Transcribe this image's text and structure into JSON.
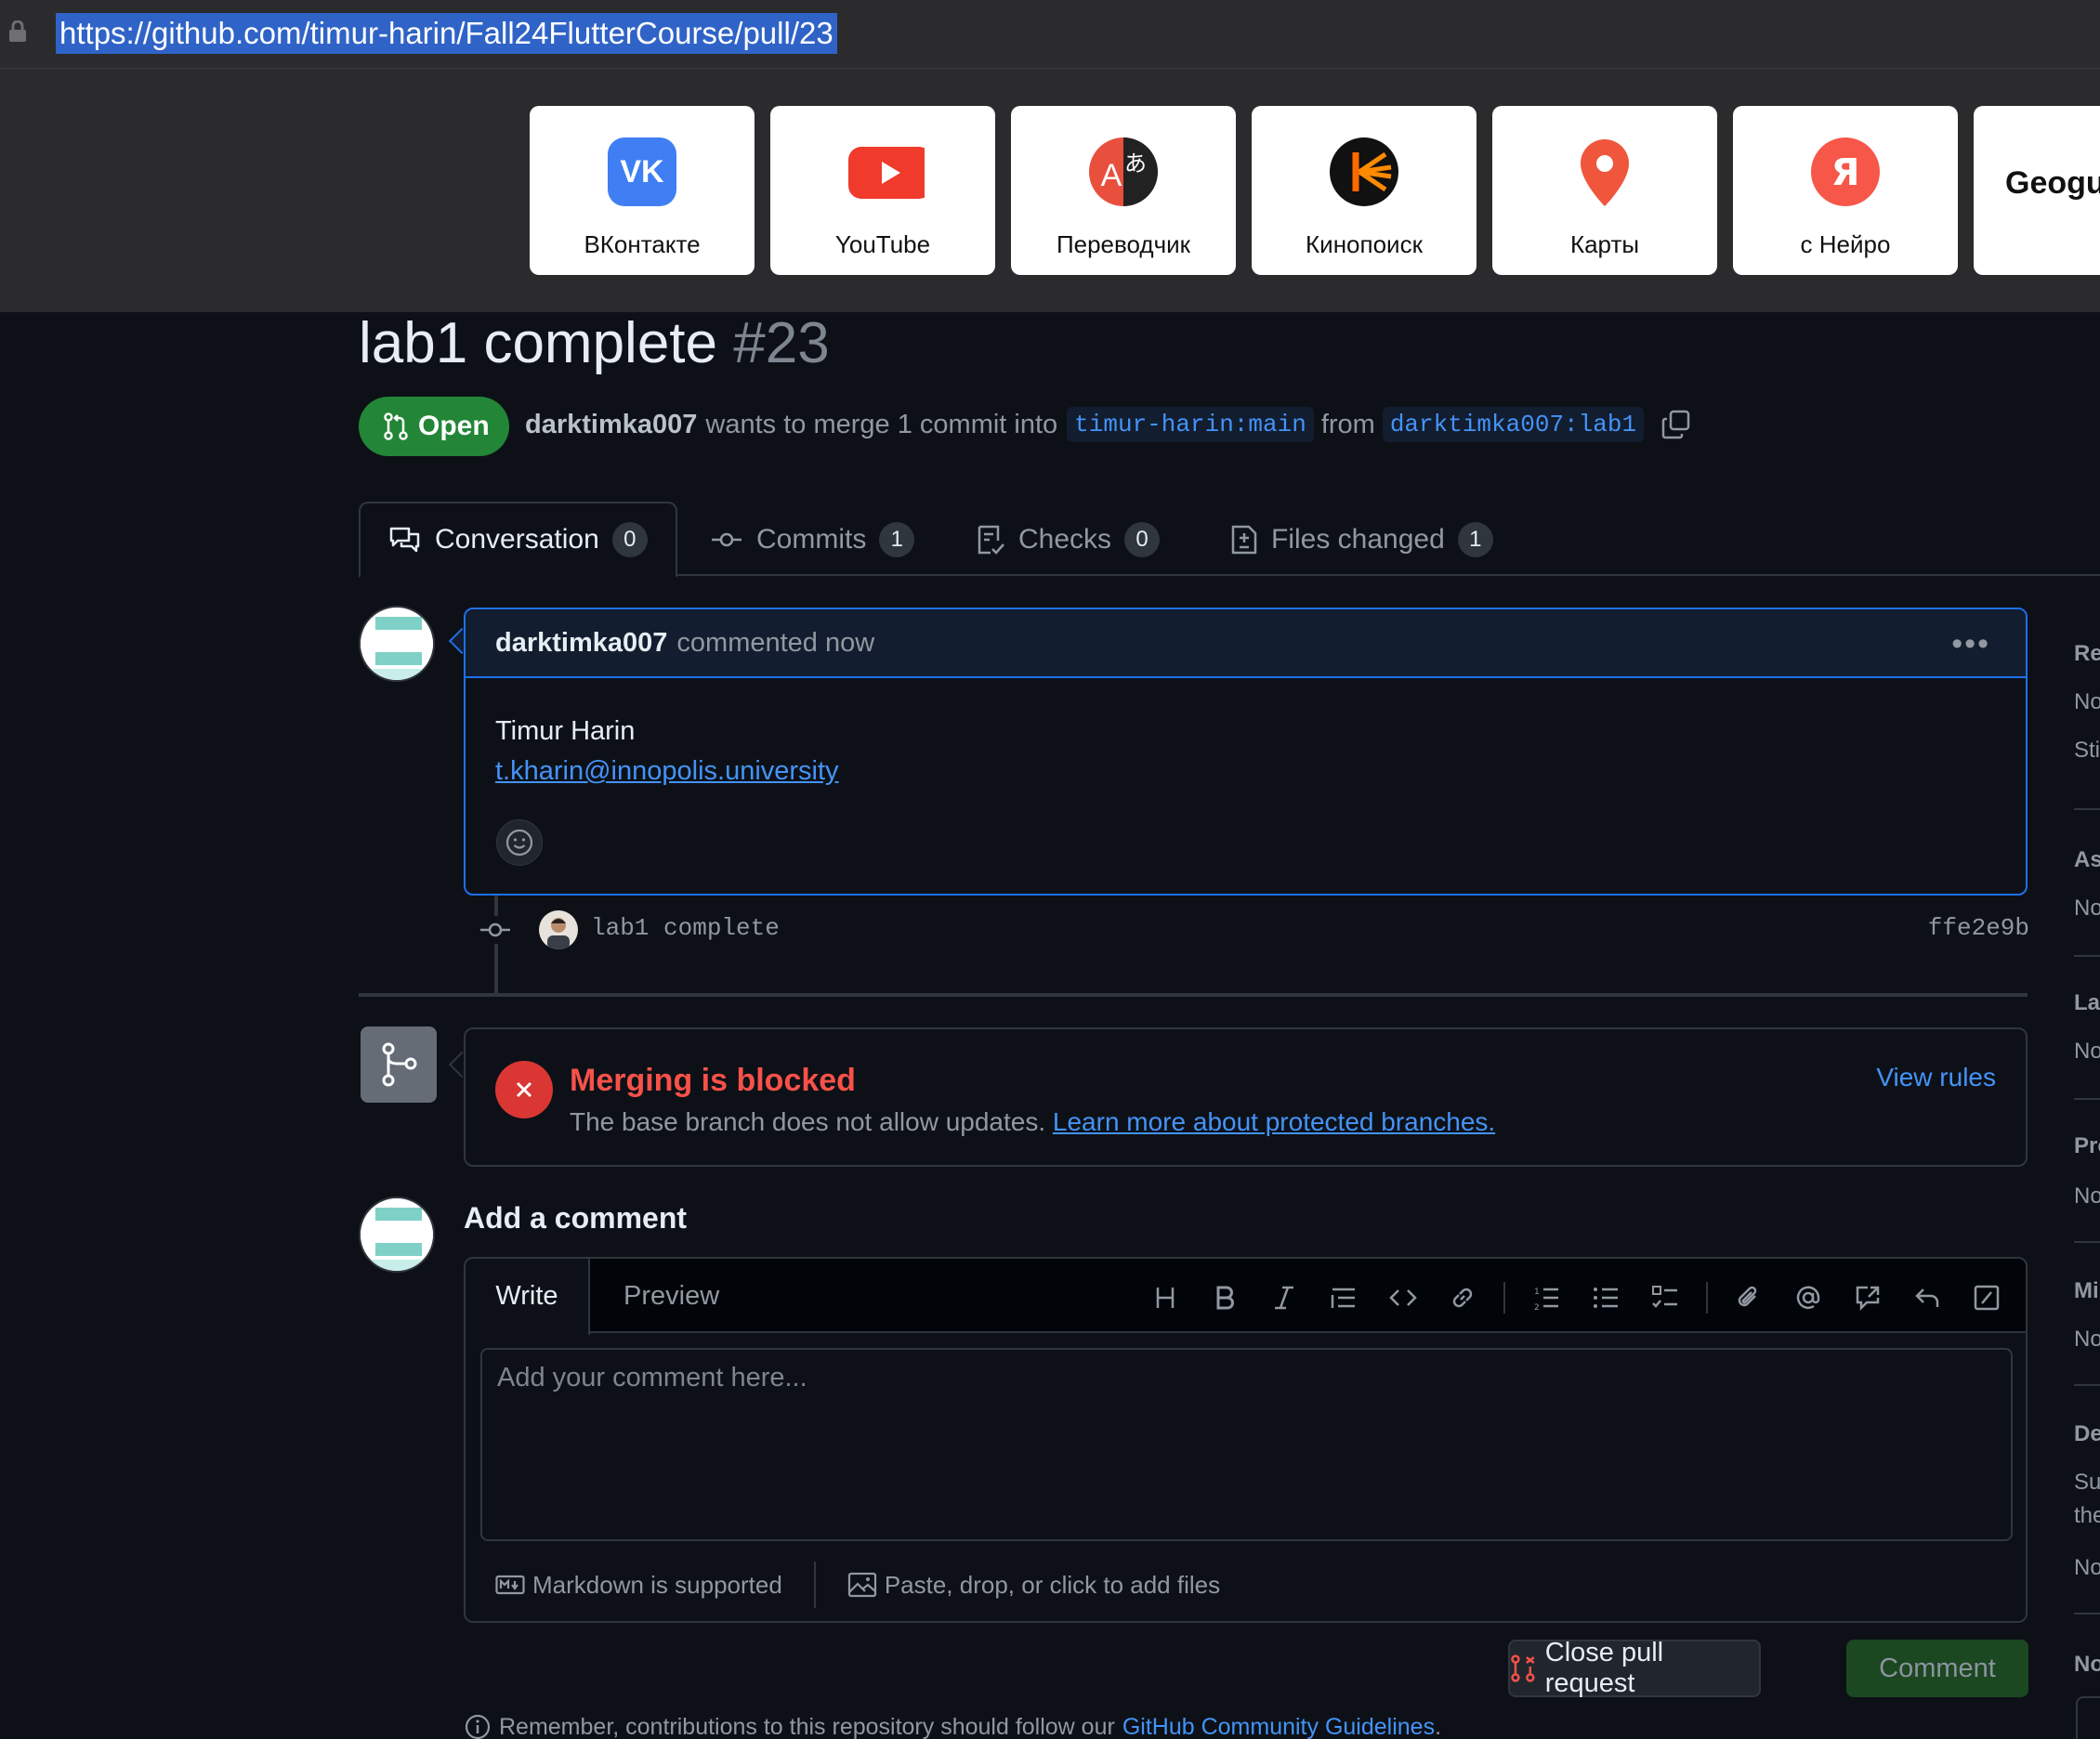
{
  "browser": {
    "url": "https://github.com/timur-harin/Fall24FlutterCourse/pull/23"
  },
  "speed_dial": [
    {
      "label": "ВКонтакте",
      "icon": "vk-icon",
      "color": "#3f7ff3"
    },
    {
      "label": "YouTube",
      "icon": "youtube-icon",
      "color": "#f03a2c"
    },
    {
      "label": "Переводчик",
      "icon": "translate-icon",
      "color": "#e8503d"
    },
    {
      "label": "Кинопоиск",
      "icon": "kinopoisk-icon",
      "color": "#ff6a00"
    },
    {
      "label": "Карты",
      "icon": "maps-pin-icon",
      "color": "#f0563b"
    },
    {
      "label": "с Нейро",
      "icon": "yandex-icon",
      "color": "#f65749"
    },
    {
      "label": "Geogu"
    }
  ],
  "pr": {
    "title": "lab1 complete",
    "number": "#23",
    "state": "Open",
    "author": "darktimka007",
    "merge_text": "wants to merge 1 commit into",
    "base_branch": "timur-harin:main",
    "from_text": "from",
    "head_branch": "darktimka007:lab1"
  },
  "tabs": [
    {
      "label": "Conversation",
      "count": "0"
    },
    {
      "label": "Commits",
      "count": "1"
    },
    {
      "label": "Checks",
      "count": "0"
    },
    {
      "label": "Files changed",
      "count": "1"
    }
  ],
  "comment": {
    "author": "darktimka007",
    "action": "commented now",
    "line1": "Timur Harin",
    "email": "t.kharin@innopolis.university"
  },
  "commit": {
    "message": "lab1 complete",
    "sha": "ffe2e9b"
  },
  "merge": {
    "title": "Merging is blocked",
    "description": "The base branch does not allow updates.",
    "link": "Learn more about protected branches.",
    "view_rules": "View rules"
  },
  "add_comment": {
    "title": "Add a comment",
    "tab_write": "Write",
    "tab_preview": "Preview",
    "placeholder": "Add your comment here...",
    "markdown_note": "Markdown is supported",
    "files_note": "Paste, drop, or click to add files",
    "close_button": "Close pull request",
    "comment_button": "Comment"
  },
  "footnote": {
    "text": "Remember, contributions to this repository should follow our",
    "link": "GitHub Community Guidelines",
    "end": "."
  },
  "sidebar": [
    {
      "label": "Rev"
    },
    {
      "label": "No"
    },
    {
      "label": "Stil"
    },
    {
      "label": "Ass"
    },
    {
      "label": "No"
    },
    {
      "label": "Lab"
    },
    {
      "label": "No"
    },
    {
      "label": "Pro"
    },
    {
      "label": "No"
    },
    {
      "label": "Mil"
    },
    {
      "label": "No"
    },
    {
      "label": "Dev"
    },
    {
      "label": "Suc"
    },
    {
      "label": "the"
    },
    {
      "label": "No"
    },
    {
      "label": "No"
    }
  ]
}
